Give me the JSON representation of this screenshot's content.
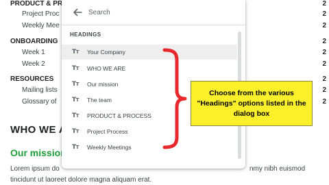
{
  "document": {
    "outline": [
      {
        "text": "PRODUCT & PR",
        "num": "2"
      },
      {
        "text": "Project Proc",
        "num": "2"
      },
      {
        "text": "Weekly Mee",
        "num": "2"
      },
      {
        "text": "ONBOARDING",
        "num": "2"
      },
      {
        "text": "Week 1",
        "num": "2"
      },
      {
        "text": "Week 2",
        "num": "2"
      },
      {
        "text": "RESOURCES",
        "num": "2"
      },
      {
        "text": "Mailing lists",
        "num": "2"
      },
      {
        "text": "Glossary of",
        "num": "2"
      }
    ],
    "heading_who": "WHO WE AR",
    "heading_mission": "Our mission",
    "para_line1_left": "Lorem ipsum do",
    "para_line1_right": "nmy nibh euismod",
    "para_line2": "tincidunt ut laoreet dolore magna aliquam erat."
  },
  "dialog": {
    "search_placeholder": "Search",
    "section_label": "HEADINGS",
    "items": [
      {
        "label": "Your Company",
        "icon": "text-style-icon"
      },
      {
        "label": "WHO WE ARE",
        "icon": "text-style-icon"
      },
      {
        "label": "Our mission",
        "icon": "text-style-icon"
      },
      {
        "label": "The team",
        "icon": "text-style-icon"
      },
      {
        "label": "PRODUCT & PROCESS",
        "icon": "text-style-icon"
      },
      {
        "label": "Project Process",
        "icon": "text-style-icon"
      },
      {
        "label": "Weekly Meetings",
        "icon": "text-style-icon"
      }
    ]
  },
  "annotation": {
    "callout_text": "Choose from the various \"Headings\" options listed in the dialog box",
    "callout_color": "#fcf02a",
    "bracket_color": "#e8272c"
  },
  "colors": {
    "mission_green": "#1e9f3a",
    "selected_row": "#eeeeee"
  }
}
